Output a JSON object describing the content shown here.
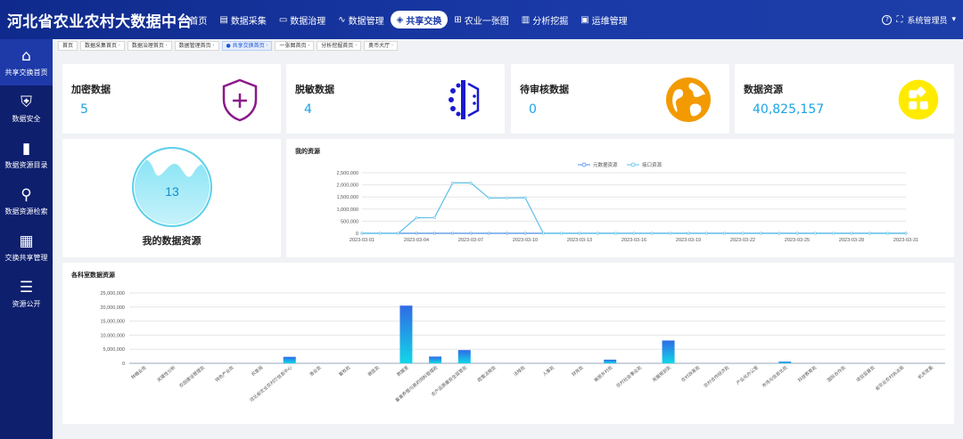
{
  "app": {
    "title": "河北省农业农村大数据中台"
  },
  "nav": [
    {
      "icon": "⌂",
      "icon_name": "home-icon",
      "label": "首页",
      "active": false
    },
    {
      "icon": "▤",
      "icon_name": "data-collect-icon",
      "label": "数据采集",
      "active": false
    },
    {
      "icon": "▭",
      "icon_name": "monitor-icon",
      "label": "数据治理",
      "active": false
    },
    {
      "icon": "∿",
      "icon_name": "wave-icon",
      "label": "数据管理",
      "active": false
    },
    {
      "icon": "◈",
      "icon_name": "layers-icon",
      "label": "共享交换",
      "active": true
    },
    {
      "icon": "⊞",
      "icon_name": "map-grid-icon",
      "label": "农业一张图",
      "active": false
    },
    {
      "icon": "▥",
      "icon_name": "bar-chart-icon",
      "label": "分析挖掘",
      "active": false
    },
    {
      "icon": "▣",
      "icon_name": "ops-icon",
      "label": "运维管理",
      "active": false
    }
  ],
  "user": {
    "help_icon": "?",
    "expand_icon": "⛶",
    "name": "系统管理员",
    "caret": "▾"
  },
  "sidebar": [
    {
      "icon": "⌂",
      "icon_name": "home-icon",
      "label": "共享交换首页",
      "active": true
    },
    {
      "icon": "⛨",
      "icon_name": "shield-bolt-icon",
      "label": "数据安全",
      "active": false
    },
    {
      "icon": "▮",
      "icon_name": "book-icon",
      "label": "数据资源目录",
      "active": false
    },
    {
      "icon": "⚲",
      "icon_name": "search-nodes-icon",
      "label": "数据资源检索",
      "active": false
    },
    {
      "icon": "▦",
      "icon_name": "grid-icon",
      "label": "交换共享管理",
      "active": false
    },
    {
      "icon": "☰",
      "icon_name": "list-icon",
      "label": "资源公开",
      "active": false
    }
  ],
  "tabs": [
    {
      "label": "首页",
      "active": false
    },
    {
      "label": "数据采集首页 ·",
      "active": false
    },
    {
      "label": "数据治理首页 ·",
      "active": false
    },
    {
      "label": "数据管理首页 ·",
      "active": false
    },
    {
      "label": "● 共享交换首页 ·",
      "active": true
    },
    {
      "label": "一张图首页 ·",
      "active": false
    },
    {
      "label": "分析挖掘首页 ·",
      "active": false
    },
    {
      "label": "奥币大厅 ·",
      "active": false
    }
  ],
  "stats": [
    {
      "label": "加密数据",
      "value": "5",
      "icon_name": "shield-plus-icon",
      "color": "#8a1a8a"
    },
    {
      "label": "脱敏数据",
      "value": "4",
      "icon_name": "dots-icon",
      "color": "#1a1acf"
    },
    {
      "label": "待审核数据",
      "value": "0",
      "icon_name": "globe-icon",
      "color": "#f29a00"
    },
    {
      "label": "数据资源",
      "value": "40,825,157",
      "icon_name": "apps-icon",
      "color": "#ffeb00"
    }
  ],
  "my_resource": {
    "value": "13",
    "label": "我的数据资源"
  },
  "line_chart": {
    "title": "我的资源",
    "chart_data": {
      "type": "line",
      "x": [
        "2023-03-01",
        "2023-03-02",
        "2023-03-03",
        "2023-03-04",
        "2023-03-05",
        "2023-03-06",
        "2023-03-07",
        "2023-03-08",
        "2023-03-09",
        "2023-03-10",
        "2023-03-11",
        "2023-03-12",
        "2023-03-13",
        "2023-03-14",
        "2023-03-15",
        "2023-03-16",
        "2023-03-17",
        "2023-03-18",
        "2023-03-19",
        "2023-03-20",
        "2023-03-21",
        "2023-03-22",
        "2023-03-23",
        "2023-03-24",
        "2023-03-25",
        "2023-03-26",
        "2023-03-27",
        "2023-03-28",
        "2023-03-29",
        "2023-03-30",
        "2023-03-31"
      ],
      "xticks": [
        "2023-03-01",
        "2023-03-04",
        "2023-03-07",
        "2023-03-10",
        "2023-03-13",
        "2023-03-16",
        "2023-03-19",
        "2023-03-22",
        "2023-03-25",
        "2023-03-28",
        "2023-03-31"
      ],
      "yticks": [
        "0",
        "500,000",
        "1,000,000",
        "1,500,000",
        "2,000,000",
        "2,500,000"
      ],
      "ylim": [
        0,
        2500000
      ],
      "legend_position": "top-center",
      "series": [
        {
          "name": "元数据资源",
          "color": "#4a90e2",
          "values": [
            0,
            0,
            0,
            0,
            0,
            0,
            0,
            0,
            0,
            0,
            0,
            0,
            0,
            0,
            0,
            0,
            0,
            0,
            0,
            0,
            0,
            0,
            0,
            0,
            0,
            0,
            0,
            0,
            0,
            0,
            0
          ]
        },
        {
          "name": "接口资源",
          "color": "#5bc0e8",
          "values": [
            0,
            0,
            0,
            640000,
            650000,
            2080000,
            2080000,
            1460000,
            1460000,
            1470000,
            0,
            0,
            0,
            0,
            0,
            0,
            0,
            0,
            0,
            0,
            0,
            0,
            0,
            0,
            0,
            0,
            0,
            0,
            0,
            0,
            0
          ]
        }
      ]
    }
  },
  "bar_chart": {
    "title": "各科室数据资源",
    "chart_data": {
      "type": "bar",
      "categories": [
        "种植业处",
        "关键性分析",
        "农田建设管理处",
        "特色产业处",
        "农垦局",
        "河北省农业农村厅信息中心",
        "渔业处",
        "畜牧处",
        "兽医处",
        "数据室",
        "畜禽养殖与兽药饲料管理处",
        "农产品质量安全监管处",
        "政策法规处",
        "法规处",
        "人事处",
        "财务处",
        "美丽乡村处",
        "农村社会事业处",
        "发展规划处",
        "农村改革处",
        "农村合作经济处",
        "产业化办公室",
        "市场与信息化处",
        "科技教育处",
        "国际合作处",
        "项目监督处",
        "省农业农村执法局",
        "机关党委"
      ],
      "values": [
        0,
        0,
        0,
        0,
        0,
        2300000,
        0,
        0,
        0,
        20500000,
        2400000,
        4700000,
        0,
        0,
        0,
        0,
        1300000,
        0,
        8100000,
        0,
        0,
        0,
        600000,
        0,
        0,
        0,
        0,
        0
      ],
      "yticks": [
        "0",
        "5,000,000",
        "10,000,000",
        "15,000,000",
        "20,000,000",
        "25,000,000"
      ],
      "ylim": [
        0,
        25000000
      ],
      "color_top": "#2f6be6",
      "color_bottom": "#12d6e8"
    }
  }
}
